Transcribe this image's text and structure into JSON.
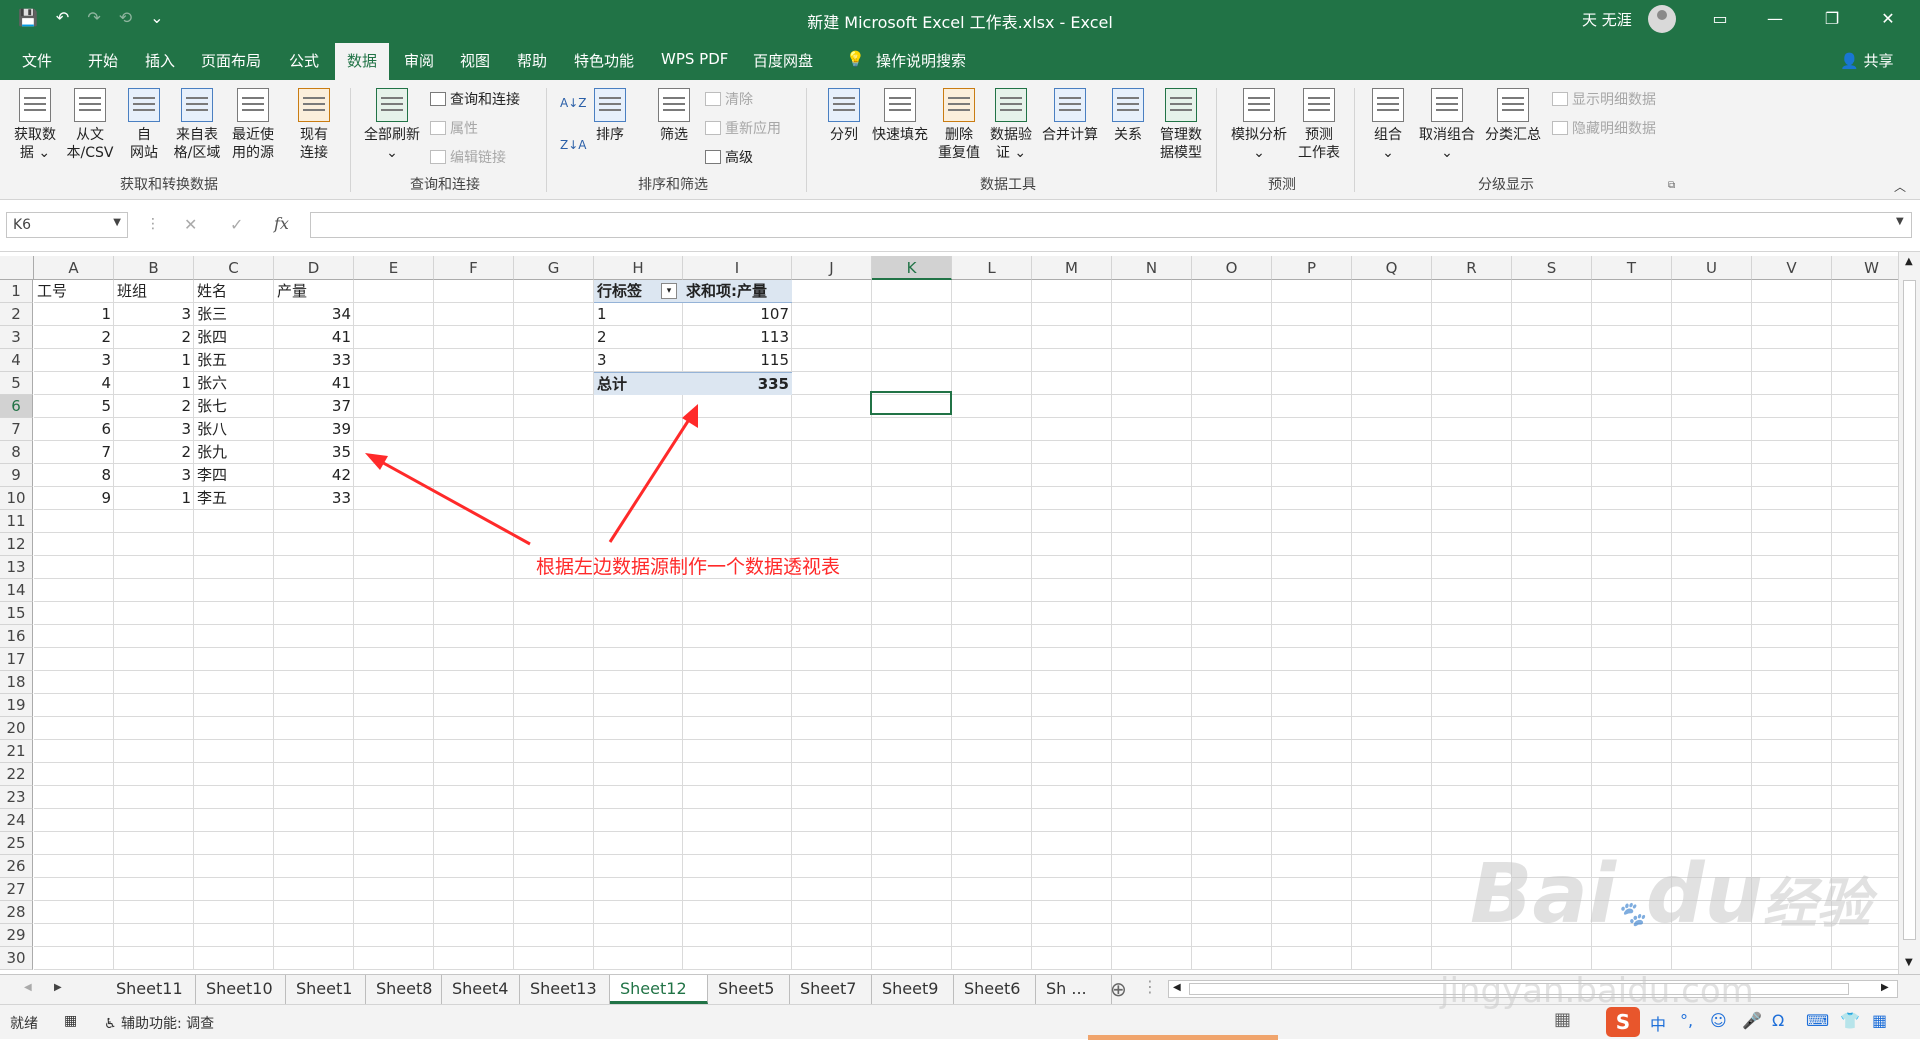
{
  "app": {
    "title": "新建 Microsoft Excel 工作表.xlsx  -  Excel",
    "user": "天 无涯",
    "win_buttons": [
      "▭",
      "—",
      "❐",
      "✕"
    ],
    "qat": [
      "💾",
      "↶",
      "↷",
      "⟲",
      "⌄",
      "⌄"
    ]
  },
  "tabs": [
    "文件",
    "开始",
    "插入",
    "页面布局",
    "公式",
    "数据",
    "审阅",
    "视图",
    "帮助",
    "特色功能",
    "WPS PDF",
    "百度网盘",
    "操作说明搜索"
  ],
  "share": "共享",
  "ribbon": {
    "get_data": [
      "获取数",
      "据 ⌄"
    ],
    "from_csv": [
      "从文",
      "本/CSV"
    ],
    "from_web": [
      "自",
      "网站"
    ],
    "from_table": [
      "来自表",
      "格/区域"
    ],
    "recent": [
      "最近使",
      "用的源"
    ],
    "existing": [
      "现有",
      "连接"
    ],
    "group1": "获取和转换数据",
    "refresh_all": [
      "全部刷新",
      "⌄"
    ],
    "queries": "查询和连接",
    "properties": "属性",
    "edit_links": "编辑链接",
    "group2": "查询和连接",
    "sort": "排序",
    "filter": "筛选",
    "clear": "清除",
    "reapply": "重新应用",
    "advanced": "高级",
    "group3": "排序和筛选",
    "text_to_col": "分列",
    "flash_fill": "快速填充",
    "remove_dup": [
      "删除",
      "重复值"
    ],
    "validation": [
      "数据验",
      "证 ⌄"
    ],
    "consolidate": "合并计算",
    "relations": "关系",
    "manage_model": [
      "管理数",
      "据模型"
    ],
    "group4": "数据工具",
    "what_if": [
      "模拟分析",
      "⌄"
    ],
    "forecast": [
      "预测",
      "工作表"
    ],
    "group5": "预测",
    "group_btn": [
      "组合",
      "⌄"
    ],
    "ungroup": [
      "取消组合",
      "⌄"
    ],
    "subtotal": "分类汇总",
    "show_detail": "显示明细数据",
    "hide_detail": "隐藏明细数据",
    "group6": "分级显示"
  },
  "formula_bar": {
    "name_box": "K6",
    "fx": "fx",
    "cancel": "✕",
    "enter": "✓",
    "value": ""
  },
  "columns": [
    "A",
    "B",
    "C",
    "D",
    "E",
    "F",
    "G",
    "H",
    "I",
    "J",
    "K",
    "L",
    "M",
    "N",
    "O",
    "P",
    "Q",
    "R",
    "S",
    "T",
    "U",
    "V",
    "W"
  ],
  "rows": [
    "1",
    "2",
    "3",
    "4",
    "5",
    "6",
    "7",
    "8",
    "9",
    "10",
    "11",
    "12",
    "13",
    "14",
    "15",
    "16",
    "17",
    "18",
    "19",
    "20",
    "21",
    "22",
    "23",
    "24",
    "25",
    "26",
    "27",
    "28",
    "29",
    "30"
  ],
  "source_table": {
    "headers": [
      "工号",
      "班组",
      "姓名",
      "产量"
    ],
    "rows": [
      [
        "1",
        "3",
        "张三",
        "34"
      ],
      [
        "2",
        "2",
        "张四",
        "41"
      ],
      [
        "3",
        "1",
        "张五",
        "33"
      ],
      [
        "4",
        "1",
        "张六",
        "41"
      ],
      [
        "5",
        "2",
        "张七",
        "37"
      ],
      [
        "6",
        "3",
        "张八",
        "39"
      ],
      [
        "7",
        "2",
        "张九",
        "35"
      ],
      [
        "8",
        "3",
        "李四",
        "42"
      ],
      [
        "9",
        "1",
        "李五",
        "33"
      ]
    ]
  },
  "pivot": {
    "row_label": "行标签",
    "value_label": "求和项:产量",
    "rows": [
      [
        "1",
        "107"
      ],
      [
        "2",
        "113"
      ],
      [
        "3",
        "115"
      ]
    ],
    "total_label": "总计",
    "total_value": "335",
    "dropdown": "▾"
  },
  "annotation": "根据左边数据源制作一个数据透视表",
  "annotation_color": "#ff2a2a",
  "sheets": [
    "Sheet11",
    "Sheet10",
    "Sheet1",
    "Sheet8",
    "Sheet4",
    "Sheet13",
    "Sheet12",
    "Sheet5",
    "Sheet7",
    "Sheet9",
    "Sheet6",
    "Sh ..."
  ],
  "active_sheet": "Sheet12",
  "add_sheet": "⊕",
  "status": {
    "ready": "就绪",
    "accessibility": "辅助功能: 调查",
    "ime": "中"
  },
  "watermark": {
    "brand": "Bai",
    "brand2": "du",
    "jingyan": "经验",
    "url": "jingyan.baidu.com"
  },
  "accent": "#217346"
}
